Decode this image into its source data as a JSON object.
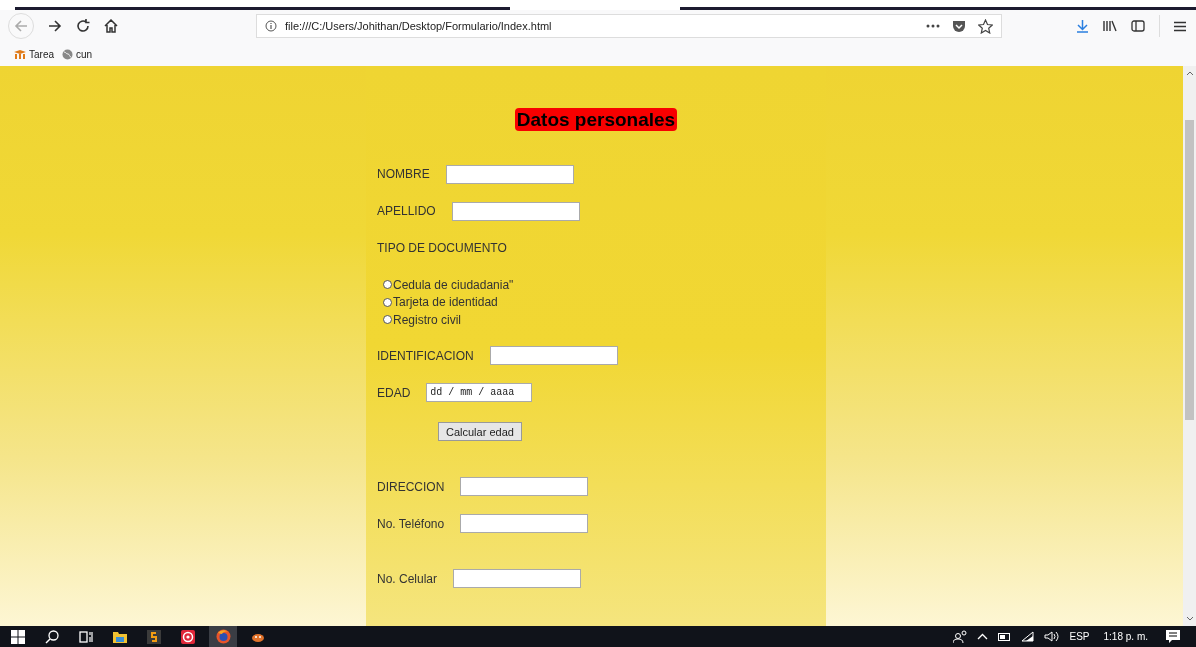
{
  "browser": {
    "url": "file:///C:/Users/Johithan/Desktop/Formulario/Index.html",
    "bookmarks": [
      {
        "label": "Tarea",
        "kind": "tarea"
      },
      {
        "label": "cun",
        "kind": "globe"
      }
    ]
  },
  "form": {
    "title": "Datos personales",
    "fields": [
      {
        "kind": "text",
        "label": "NOMBRE"
      },
      {
        "kind": "text",
        "label": "APELLIDO"
      },
      {
        "kind": "heading",
        "label": "TIPO DE DOCUMENTO"
      },
      {
        "kind": "radio",
        "options": [
          {
            "label": "Cedula de ciudadania\"",
            "selected": false
          },
          {
            "label": "Tarjeta de identidad",
            "selected": false
          },
          {
            "label": "Registro civil",
            "selected": false
          }
        ]
      },
      {
        "kind": "text",
        "label": "IDENTIFICACION"
      },
      {
        "kind": "date",
        "label": "EDAD",
        "placeholder": "dd / mm / aaaa"
      },
      {
        "kind": "button",
        "label": "Calcular edad"
      },
      {
        "kind": "text",
        "label": "DIRECCION"
      },
      {
        "kind": "text",
        "label": "No. Teléfono"
      },
      {
        "kind": "text",
        "label": "No. Celular"
      }
    ]
  },
  "taskbar": {
    "language": "ESP",
    "time": "1:18 p. m."
  }
}
